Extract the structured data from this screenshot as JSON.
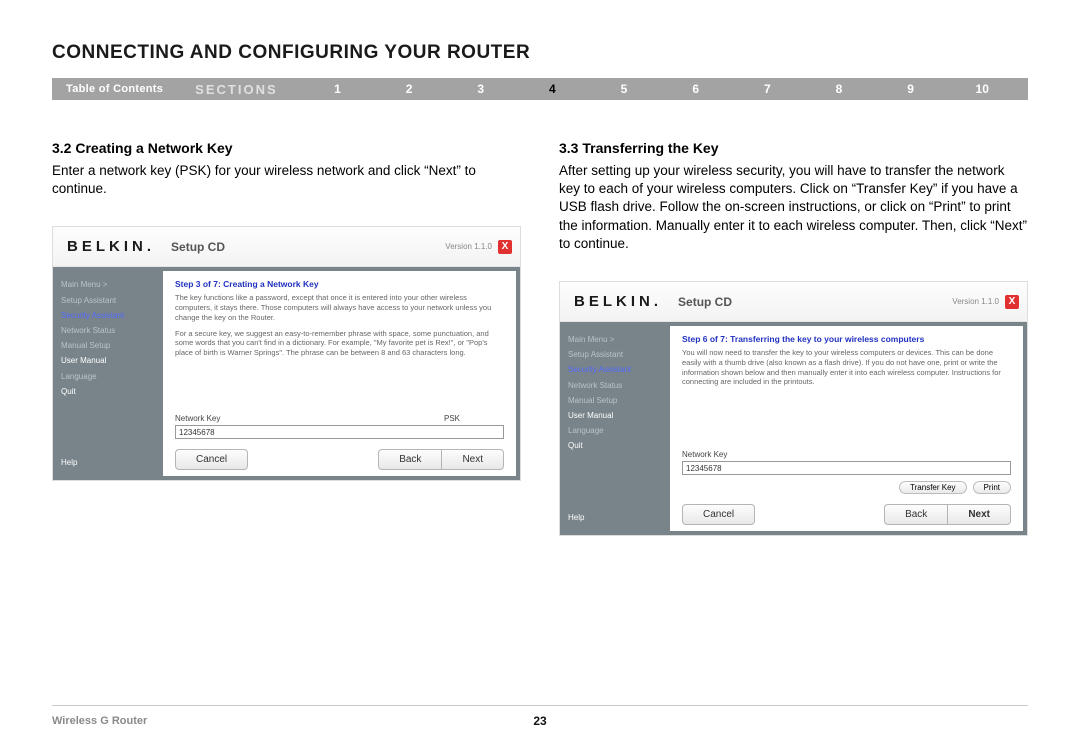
{
  "title": "CONNECTING AND CONFIGURING YOUR ROUTER",
  "nav": {
    "toc": "Table of Contents",
    "sections": "SECTIONS",
    "items": [
      "1",
      "2",
      "3",
      "4",
      "5",
      "6",
      "7",
      "8",
      "9",
      "10"
    ],
    "current": "4"
  },
  "left": {
    "heading": "3.2 Creating a Network Key",
    "body": "Enter a network key (PSK) for your wireless network and click “Next” to continue."
  },
  "right": {
    "heading": "3.3 Transferring the Key",
    "body": "After setting up your wireless security, you will have to transfer the network key to each of your wireless computers. Click on “Transfer Key” if you have a USB flash drive. Follow the on-screen instructions, or click on “Print” to print the information. Manually enter it to each wireless computer. Then, click “Next” to continue."
  },
  "shot_common": {
    "brand": "BELKIN",
    "brand_dot": ".",
    "setup": "Setup CD",
    "version": "Version 1.1.0",
    "close": "X",
    "menu": {
      "main": "Main Menu  >",
      "setup_assistant": "Setup Assistant",
      "security_assistant": "Security Assistant",
      "network_status": "Network Status",
      "manual_setup": "Manual Setup",
      "user_manual": "User Manual",
      "language": "Language",
      "quit": "Quit",
      "help": "Help"
    },
    "buttons": {
      "cancel": "Cancel",
      "back": "Back",
      "next": "Next"
    }
  },
  "shot_left": {
    "step_title": "Step 3 of 7: Creating a Network Key",
    "p1": "The key functions like a password, except that once it is entered into your other wireless computers, it stays there. Those computers will always have access to your network unless you change the key on the Router.",
    "p2": "For a secure key, we suggest an easy-to-remember phrase with space, some punctuation, and some words that you can't find in a dictionary. For example, \"My favorite pet is Rex!\", or \"Pop's place of birth is Warner Springs\". The phrase can be between 8 and 63 characters long.",
    "label_key": "Network Key",
    "label_psk": "PSK",
    "value": "12345678"
  },
  "shot_right": {
    "step_title": "Step 6 of 7: Transferring the key to your wireless computers",
    "p1": "You will now need to transfer the key to your wireless computers or devices. This can be done easily with a thumb drive (also known as a flash drive). If you do not have one, print or write the information shown below and then manually enter it into each wireless computer. Instructions for connecting are included in the printouts.",
    "label_key": "Network Key",
    "value": "12345678",
    "transfer": "Transfer Key",
    "print": "Print"
  },
  "footer": {
    "product": "Wireless G Router",
    "page": "23"
  }
}
